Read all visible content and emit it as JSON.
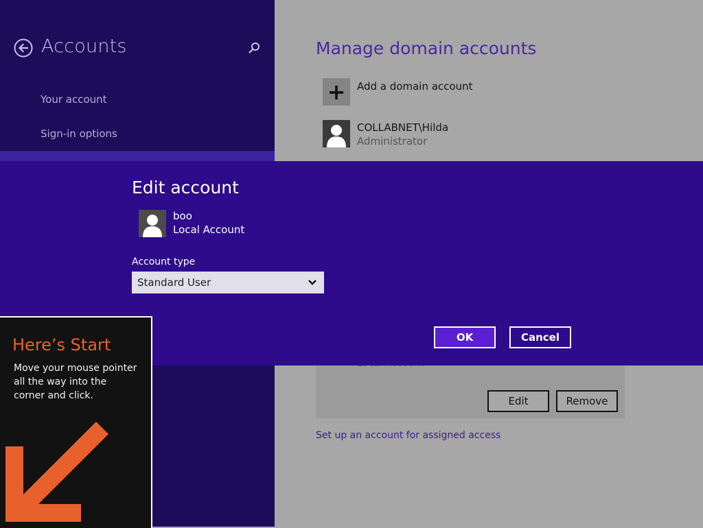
{
  "left_pane": {
    "title": "Accounts",
    "nav": [
      "Your account",
      "Sign-in options"
    ]
  },
  "main": {
    "section_title": "Manage domain accounts",
    "add_domain_label": "Add a domain account",
    "domain_user": {
      "name": "COLLABNET\\Hilda",
      "role": "Administrator"
    },
    "selected_account_partial": "Local Account",
    "edit_label": "Edit",
    "remove_label": "Remove",
    "assigned_access_link": "Set up an account for assigned access"
  },
  "dialog": {
    "title": "Edit account",
    "user_name": "boo",
    "user_kind": "Local Account",
    "type_label": "Account type",
    "type_value": "Standard User",
    "ok_label": "OK",
    "cancel_label": "Cancel"
  },
  "tip": {
    "title": "Here’s Start",
    "body": "Move your mouse pointer all the way into the corner and click."
  },
  "colors": {
    "pane_bg": "#1c0d5a",
    "dialog_bg": "#2d0b8a",
    "ok_bg": "#5a1fd1",
    "tip_accent": "#e8612c",
    "dim_bg": "#a7a7a7"
  }
}
